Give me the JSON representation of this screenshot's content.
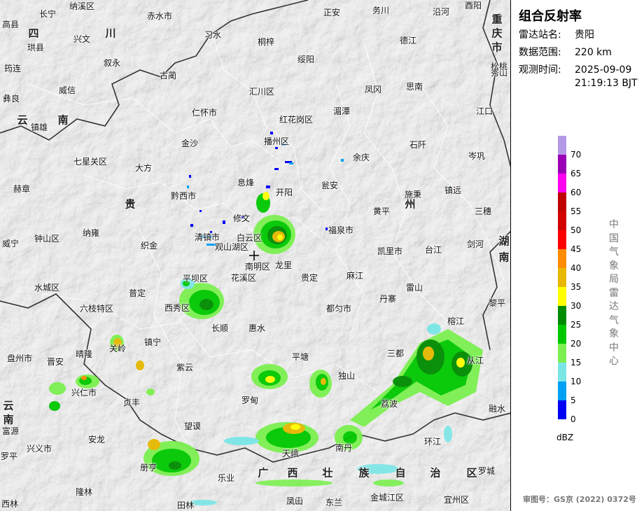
{
  "panel": {
    "title": "组合反射率",
    "station_label": "雷达站名:",
    "station_value": "贵阳",
    "range_label": "数据范围:",
    "range_value": "220 km",
    "time_label": "观测时间:",
    "time_date": "2025-09-09",
    "time_clock": "21:19:13 BJT",
    "vertical_text": "中国气象局雷达气象中心",
    "approval": "审图号：GS京 (2022) 0372号"
  },
  "legend": {
    "unit": "dBZ",
    "levels": [
      {
        "label": "",
        "color": "#b49ae6"
      },
      {
        "label": "70",
        "color": "#9a00b4"
      },
      {
        "label": "65",
        "color": "#ff00f0"
      },
      {
        "label": "60",
        "color": "#c00000"
      },
      {
        "label": "55",
        "color": "#d40000"
      },
      {
        "label": "50",
        "color": "#ff0000"
      },
      {
        "label": "45",
        "color": "#ff8c00"
      },
      {
        "label": "40",
        "color": "#e6b800"
      },
      {
        "label": "35",
        "color": "#ffff00"
      },
      {
        "label": "30",
        "color": "#008c00"
      },
      {
        "label": "25",
        "color": "#00c800"
      },
      {
        "label": "20",
        "color": "#7cf050"
      },
      {
        "label": "15",
        "color": "#7ae6e6"
      },
      {
        "label": "10",
        "color": "#00a0f5"
      },
      {
        "label": "5",
        "color": "#0000f5"
      },
      {
        "label": "0",
        "color": ""
      }
    ]
  },
  "map": {
    "province_labels": [
      "四",
      "川",
      "云",
      "南",
      "贵",
      "州",
      "广",
      "西",
      "壮",
      "族",
      "自",
      "治",
      "区",
      "重",
      "庆",
      "市",
      "湖",
      "南",
      "云",
      "南"
    ],
    "cities": [
      "长宁",
      "纳溪区",
      "赤水市",
      "正安",
      "务川",
      "沿河",
      "酉阳",
      "高县",
      "兴文",
      "习水",
      "秀山",
      "珙县",
      "德江",
      "松桃",
      "筠连",
      "叙永",
      "古蔺",
      "桐梓",
      "绥阳",
      "威信",
      "汇川区",
      "凤冈",
      "思南",
      "彝良",
      "仁怀市",
      "湄潭",
      "江口",
      "红花岗区",
      "镇雄",
      "金沙",
      "播州区",
      "石阡",
      "七星关区",
      "大方",
      "余庆",
      "岑巩",
      "赫章",
      "息烽",
      "开阳",
      "瓮安",
      "施秉",
      "镇远",
      "黔西市",
      "黄平",
      "三穗",
      "修文",
      "福泉市",
      "钟山区",
      "纳雍",
      "清镇市",
      "白云区",
      "剑河",
      "织金",
      "观山湖区",
      "凯里市",
      "台江",
      "威宁",
      "南明区",
      "龙里",
      "水城区",
      "平坝区",
      "花溪区",
      "贵定",
      "麻江",
      "普定",
      "雷山",
      "丹寨",
      "六枝特区",
      "西秀区",
      "都匀市",
      "黎平",
      "长顺",
      "惠水",
      "榕江",
      "关岭",
      "镇宁",
      "三都",
      "盘州市",
      "晴隆",
      "平塘",
      "晋安",
      "紫云",
      "独山",
      "从江",
      "荔波",
      "兴仁市",
      "贞丰",
      "罗甸",
      "融水",
      "富源",
      "望谟",
      "安龙",
      "环江",
      "兴义市",
      "罗平",
      "册亨",
      "南丹",
      "天峨",
      "罗城",
      "乐业",
      "凌云",
      "隆林",
      "田林",
      "凤山",
      "东兰",
      "金城江区",
      "宜州区",
      "西林"
    ]
  }
}
